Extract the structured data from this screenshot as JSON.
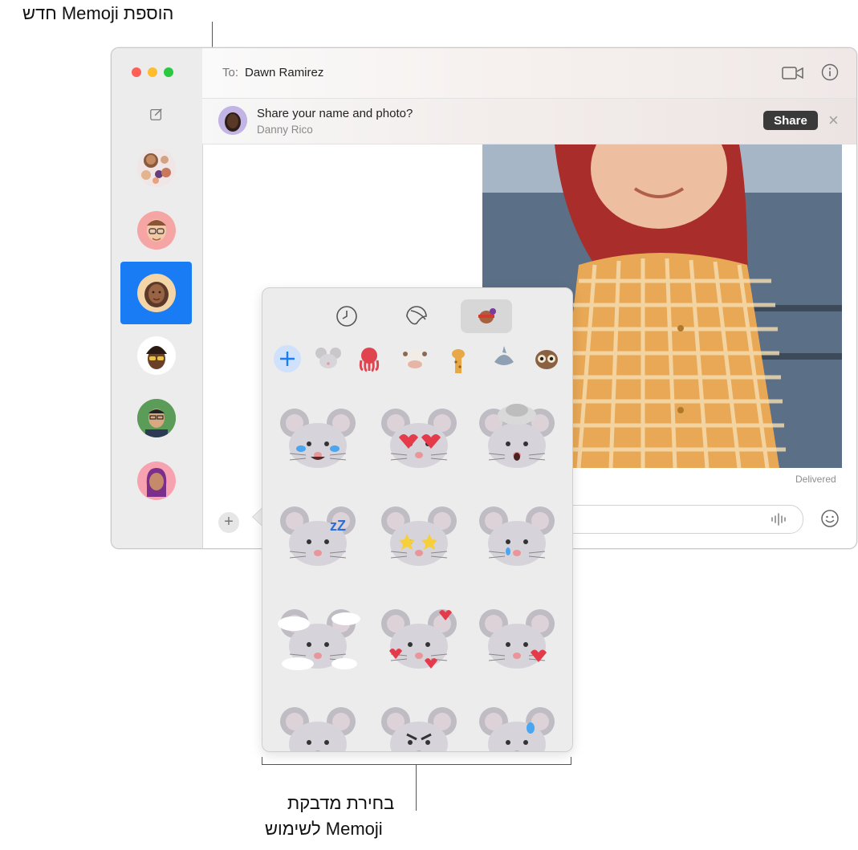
{
  "callouts": {
    "top": "הוספת Memoji חדש",
    "bottom_line1": "בחירת מדבקת",
    "bottom_line2": "Memoji לשימוש"
  },
  "header": {
    "to_label": "To:",
    "recipient": "Dawn Ramirez",
    "video_icon": "video-camera-icon",
    "info_icon": "info-icon"
  },
  "share_banner": {
    "title": "Share your name and photo?",
    "sender": "Danny Rico",
    "button_label": "Share"
  },
  "conversation": {
    "status": "Delivered"
  },
  "sticker_picker": {
    "tabs": [
      "recents-clock-icon",
      "stickers-icon",
      "memoji-icon"
    ],
    "selected_tab": "memoji-icon",
    "strip": [
      "add-memoji-icon",
      "mouse-icon",
      "octopus-icon",
      "cow-icon",
      "giraffe-icon",
      "shark-icon",
      "owl-icon"
    ],
    "stickers": [
      "mouse-crying-laughing",
      "mouse-heart-eyes",
      "mouse-mind-blown",
      "mouse-sleeping",
      "mouse-star-struck",
      "mouse-crying",
      "mouse-in-clouds",
      "mouse-hearts-around",
      "mouse-blowing-kiss",
      "mouse-winking",
      "mouse-angry",
      "mouse-sweating"
    ]
  },
  "colors": {
    "accent": "#1a7cf5",
    "close": "#fe5f57",
    "minimize": "#febc2e",
    "zoom": "#28c840"
  }
}
